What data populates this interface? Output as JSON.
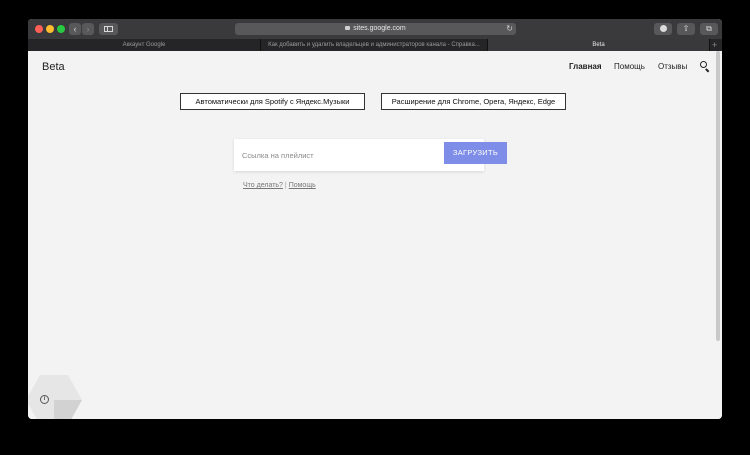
{
  "browser": {
    "address": "sites.google.com",
    "tabs": [
      {
        "label": "Аккаунт Google"
      },
      {
        "label": "Как добавить и удалить владельцев и администраторов канала - Справка..."
      },
      {
        "label": "Beta"
      }
    ],
    "icons": {
      "back": "chevron-left-icon",
      "forward": "chevron-right-icon",
      "sidebar": "sidebar-icon",
      "lock": "lock-icon",
      "reload": "reload-icon",
      "download": "download-icon",
      "share": "share-icon",
      "tabs": "tabs-overview-icon",
      "new_tab": "plus-icon"
    }
  },
  "site": {
    "title": "Beta",
    "nav": {
      "home": "Главная",
      "help": "Помощь",
      "reviews": "Отзывы"
    },
    "buttons": {
      "spotify": "Автоматически для Spotify с Яндекс.Музыки",
      "browser": "Расширение для Chrome, Opera, Яндекс, Edge"
    },
    "form": {
      "placeholder": "Ссылка на плейлист",
      "value": "",
      "submit": "ЗАГРУЗИТЬ"
    },
    "help_row": {
      "what_to_do": "Что делать?",
      "separator": "|",
      "help": "Помощь"
    },
    "accent_color": "#7e8ee8"
  }
}
